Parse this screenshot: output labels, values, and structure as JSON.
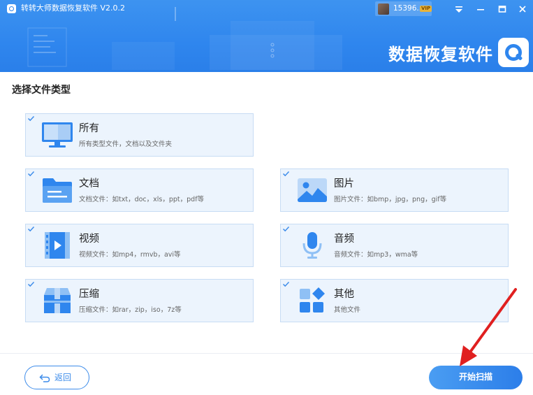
{
  "header": {
    "title": "转转大师数据恢复软件 V2.0.2",
    "user_id": "15396...",
    "vip_badge": "VIP",
    "banner_title": "数据恢复软件",
    "brand_color": "#2f86ee"
  },
  "window_controls": [
    {
      "icon": "menu-dropdown-icon"
    },
    {
      "icon": "minimize-icon"
    },
    {
      "icon": "maximize-icon"
    },
    {
      "icon": "close-icon"
    }
  ],
  "main": {
    "section_title": "选择文件类型",
    "file_types": [
      {
        "key": "all",
        "name": "所有",
        "desc": "所有类型文件，文档以及文件夹",
        "checked": true,
        "icon": "monitor-icon"
      },
      {
        "key": "doc",
        "name": "文档",
        "desc": "文档文件：如txt，doc，xls，ppt，pdf等",
        "checked": true,
        "icon": "folder-icon"
      },
      {
        "key": "img",
        "name": "图片",
        "desc": "图片文件：如bmp，jpg，png，gif等",
        "checked": true,
        "icon": "image-icon"
      },
      {
        "key": "video",
        "name": "视频",
        "desc": "视频文件：如mp4，rmvb，avi等",
        "checked": true,
        "icon": "video-icon"
      },
      {
        "key": "audio",
        "name": "音频",
        "desc": "音频文件：如mp3，wma等",
        "checked": true,
        "icon": "microphone-icon"
      },
      {
        "key": "zip",
        "name": "压缩",
        "desc": "压缩文件：如rar，zip，iso，7z等",
        "checked": true,
        "icon": "archive-icon"
      },
      {
        "key": "other",
        "name": "其他",
        "desc": "其他文件",
        "checked": true,
        "icon": "apps-grid-icon"
      }
    ]
  },
  "footer": {
    "back_label": "返回",
    "scan_label": "开始扫描"
  }
}
